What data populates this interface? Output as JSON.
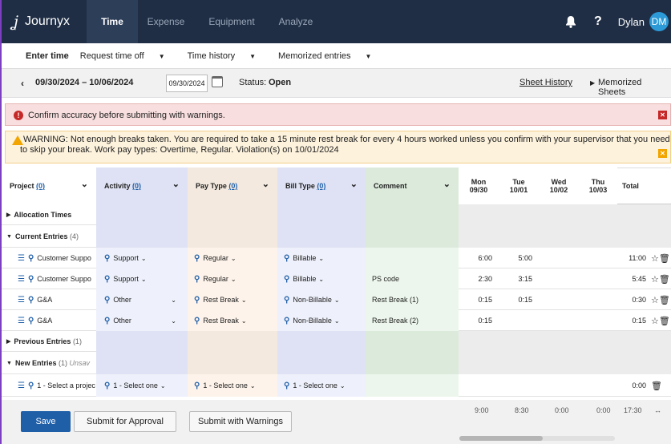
{
  "nav": {
    "brand": "Journyx",
    "tabs": [
      "Time",
      "Expense",
      "Equipment",
      "Analyze"
    ],
    "help": "?",
    "user_name": "Dylan",
    "avatar_initials": "DM"
  },
  "subnav": {
    "items": [
      "Enter time",
      "Request time off",
      "Time history",
      "Memorized entries"
    ]
  },
  "datebar": {
    "range": "09/30/2024 – 10/06/2024",
    "date_value": "09/30/2024",
    "status_label": "Status:",
    "status_value": "Open",
    "sheet_history": "Sheet History",
    "memorized_sheets": "Memorized Sheets"
  },
  "alerts": {
    "error": "Confirm accuracy before submitting with warnings.",
    "warning_line1": "WARNING: Not enough breaks taken. You are required to take a 15 minute rest break for every 4 hours worked unless you confirm with your supervisor that you need",
    "warning_line2": "to skip your break. Work pay types: Overtime, Regular. Violation(s) on 10/01/2024"
  },
  "grid": {
    "col_project": "Project",
    "col_activity": "Activity",
    "col_paytype": "Pay Type",
    "col_billtype": "Bill Type",
    "col_comment": "Comment",
    "filter_count": "(0)",
    "days": [
      {
        "day": "Mon",
        "date": "09/30"
      },
      {
        "day": "Tue",
        "date": "10/01"
      },
      {
        "day": "Wed",
        "date": "10/02"
      },
      {
        "day": "Thu",
        "date": "10/03"
      }
    ],
    "col_total": "Total",
    "groups": {
      "allocation": "Allocation Times",
      "current": "Current Entries",
      "current_count": "(4)",
      "previous": "Previous Entries",
      "previous_count": "(1)",
      "new": "New Entries",
      "new_count": "(1)",
      "new_note": "Unsav"
    },
    "rows": [
      {
        "project": "Customer Suppo",
        "activity": "Support",
        "pay": "Regular",
        "bill": "Billable",
        "comment": "",
        "mon": "6:00",
        "tue": "5:00",
        "total": "11:00"
      },
      {
        "project": "Customer Suppo",
        "activity": "Support",
        "pay": "Regular",
        "bill": "Billable",
        "comment": "PS code",
        "mon": "2:30",
        "tue": "3:15",
        "total": "5:45"
      },
      {
        "project": "G&A",
        "activity": "Other",
        "pay": "Rest Break",
        "bill": "Non-Billable",
        "comment": "Rest Break (1)",
        "mon": "0:15",
        "tue": "0:15",
        "total": "0:30"
      },
      {
        "project": "G&A",
        "activity": "Other",
        "pay": "Rest Break",
        "bill": "Non-Billable",
        "comment": "Rest Break (2)",
        "mon": "0:15",
        "tue": "",
        "total": "0:15"
      }
    ],
    "new_row": {
      "project": "1 - Select a projec",
      "activity": "1 - Select one",
      "pay": "1 - Select one",
      "bill": "1 - Select one",
      "total": "0:00"
    }
  },
  "footer": {
    "save": "Save",
    "submit": "Submit for Approval",
    "submit_warnings": "Submit with Warnings",
    "totals": [
      "9:00",
      "8:30",
      "0:00",
      "0:00",
      "17:30"
    ],
    "arrows": "↔"
  },
  "colors": {
    "nav_bg": "#1f2e45",
    "primary": "#1f5fa8",
    "error_bg": "#f8dede",
    "warning_bg": "#fdf2dc"
  }
}
